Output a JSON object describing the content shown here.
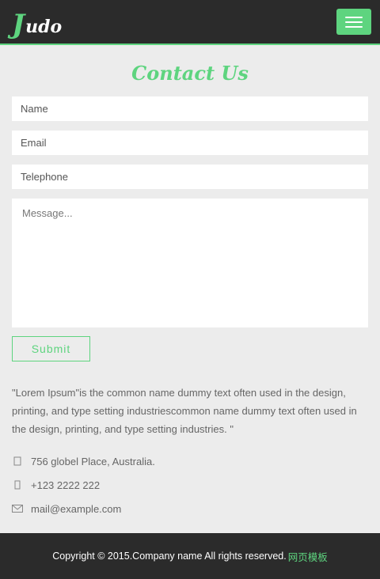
{
  "header": {
    "logo_initial": "J",
    "logo_rest": "udo",
    "accent_color": "#5ed47f",
    "menu_icon": "hamburger-icon"
  },
  "contact": {
    "title": "Contact Us",
    "name_placeholder": "Name",
    "email_placeholder": "Email",
    "telephone_placeholder": "Telephone",
    "message_placeholder": "Message...",
    "submit_label": "Submit"
  },
  "about": {
    "text": "\"Lorem Ipsum\"is the common name dummy text often used in the design, printing, and type setting industriescommon name dummy text often used in the design, printing, and type setting industries. \""
  },
  "info": {
    "address": "756 globel Place, Australia.",
    "phone": "+123 2222 222",
    "email": "mail@example.com"
  },
  "footer": {
    "copyright": "Copyright © 2015.Company name All rights reserved.",
    "link_text": "网页模板"
  }
}
